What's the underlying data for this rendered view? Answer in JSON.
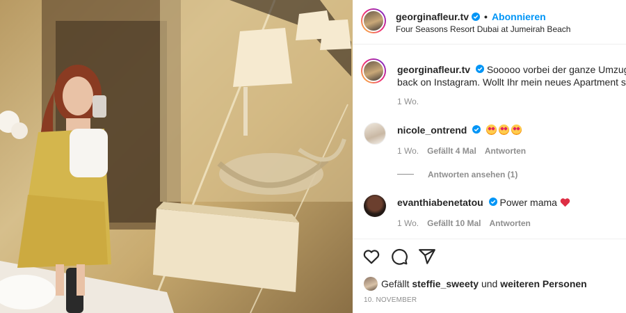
{
  "post": {
    "image_description_label": "Photo",
    "header": {
      "username": "georginafleur.tv",
      "separator": "•",
      "follow_label": "Abonnieren",
      "location": "Four Seasons Resort Dubai at Jumeirah Beach"
    },
    "caption": {
      "username": "georginafleur.tv",
      "text": "Sooooo vorbei der ganze Umzugss",
      "text_line2": "back on Instagram. Wollt Ihr mein neues Apartment se",
      "time": "1 Wo."
    },
    "comments": [
      {
        "username": "nicole_ontrend",
        "text": "",
        "emoji_count": 3,
        "time": "1 Wo.",
        "likes": "Gefällt 4 Mal",
        "reply_label": "Antworten",
        "view_replies": "Antworten ansehen (1)"
      },
      {
        "username": "evanthiabenetatou",
        "text": "Power mama",
        "time": "1 Wo.",
        "likes": "Gefällt 10 Mal",
        "reply_label": "Antworten"
      }
    ],
    "liked_by": {
      "prefix": "Gefällt",
      "user": "steffie_sweety",
      "middle": "und",
      "suffix": "weiteren Personen"
    },
    "date": "10. NOVEMBER"
  },
  "colors": {
    "accent_blue": "#0095f6",
    "muted_text": "#8e8e8e",
    "heart_red": "#e0245e"
  },
  "icons": [
    "verified-badge-icon",
    "heart-icon",
    "comment-icon",
    "share-icon",
    "heart-emoji-icon",
    "star-struck-emoji-icon"
  ]
}
